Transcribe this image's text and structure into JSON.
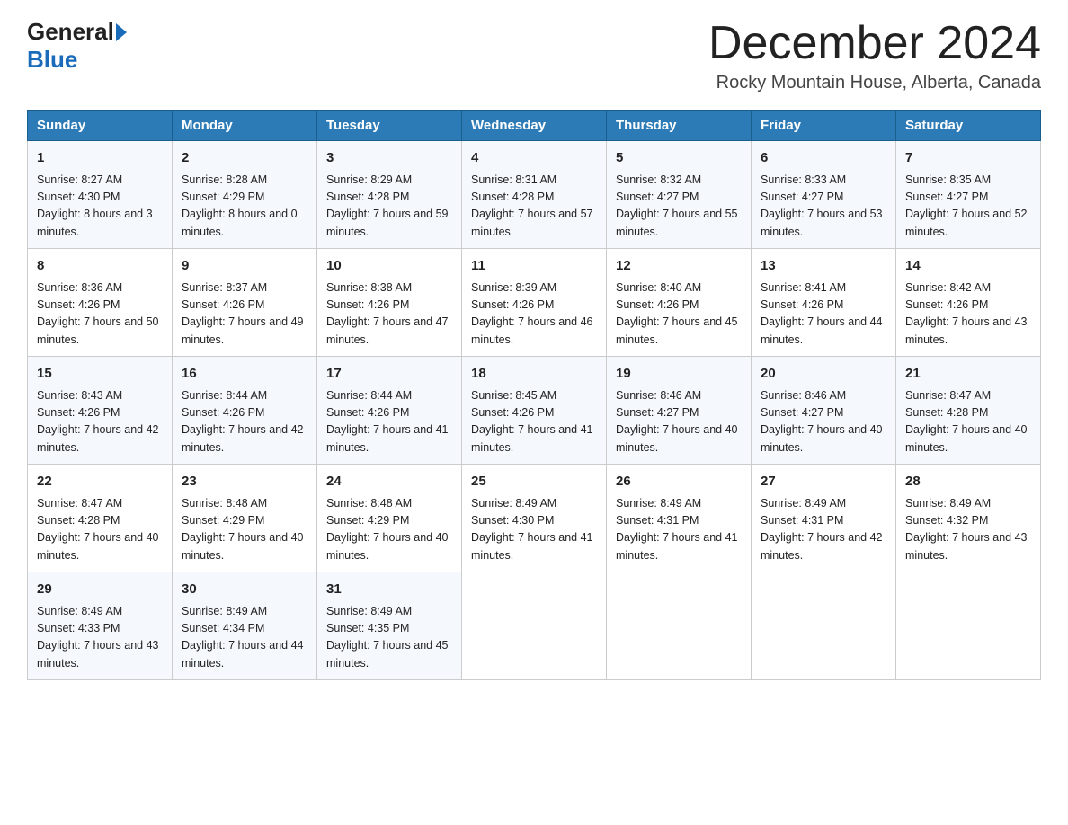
{
  "header": {
    "logo_general": "General",
    "logo_blue": "Blue",
    "month_title": "December 2024",
    "location": "Rocky Mountain House, Alberta, Canada"
  },
  "days_of_week": [
    "Sunday",
    "Monday",
    "Tuesday",
    "Wednesday",
    "Thursday",
    "Friday",
    "Saturday"
  ],
  "weeks": [
    [
      {
        "day": "1",
        "sunrise": "8:27 AM",
        "sunset": "4:30 PM",
        "daylight": "8 hours and 3 minutes."
      },
      {
        "day": "2",
        "sunrise": "8:28 AM",
        "sunset": "4:29 PM",
        "daylight": "8 hours and 0 minutes."
      },
      {
        "day": "3",
        "sunrise": "8:29 AM",
        "sunset": "4:28 PM",
        "daylight": "7 hours and 59 minutes."
      },
      {
        "day": "4",
        "sunrise": "8:31 AM",
        "sunset": "4:28 PM",
        "daylight": "7 hours and 57 minutes."
      },
      {
        "day": "5",
        "sunrise": "8:32 AM",
        "sunset": "4:27 PM",
        "daylight": "7 hours and 55 minutes."
      },
      {
        "day": "6",
        "sunrise": "8:33 AM",
        "sunset": "4:27 PM",
        "daylight": "7 hours and 53 minutes."
      },
      {
        "day": "7",
        "sunrise": "8:35 AM",
        "sunset": "4:27 PM",
        "daylight": "7 hours and 52 minutes."
      }
    ],
    [
      {
        "day": "8",
        "sunrise": "8:36 AM",
        "sunset": "4:26 PM",
        "daylight": "7 hours and 50 minutes."
      },
      {
        "day": "9",
        "sunrise": "8:37 AM",
        "sunset": "4:26 PM",
        "daylight": "7 hours and 49 minutes."
      },
      {
        "day": "10",
        "sunrise": "8:38 AM",
        "sunset": "4:26 PM",
        "daylight": "7 hours and 47 minutes."
      },
      {
        "day": "11",
        "sunrise": "8:39 AM",
        "sunset": "4:26 PM",
        "daylight": "7 hours and 46 minutes."
      },
      {
        "day": "12",
        "sunrise": "8:40 AM",
        "sunset": "4:26 PM",
        "daylight": "7 hours and 45 minutes."
      },
      {
        "day": "13",
        "sunrise": "8:41 AM",
        "sunset": "4:26 PM",
        "daylight": "7 hours and 44 minutes."
      },
      {
        "day": "14",
        "sunrise": "8:42 AM",
        "sunset": "4:26 PM",
        "daylight": "7 hours and 43 minutes."
      }
    ],
    [
      {
        "day": "15",
        "sunrise": "8:43 AM",
        "sunset": "4:26 PM",
        "daylight": "7 hours and 42 minutes."
      },
      {
        "day": "16",
        "sunrise": "8:44 AM",
        "sunset": "4:26 PM",
        "daylight": "7 hours and 42 minutes."
      },
      {
        "day": "17",
        "sunrise": "8:44 AM",
        "sunset": "4:26 PM",
        "daylight": "7 hours and 41 minutes."
      },
      {
        "day": "18",
        "sunrise": "8:45 AM",
        "sunset": "4:26 PM",
        "daylight": "7 hours and 41 minutes."
      },
      {
        "day": "19",
        "sunrise": "8:46 AM",
        "sunset": "4:27 PM",
        "daylight": "7 hours and 40 minutes."
      },
      {
        "day": "20",
        "sunrise": "8:46 AM",
        "sunset": "4:27 PM",
        "daylight": "7 hours and 40 minutes."
      },
      {
        "day": "21",
        "sunrise": "8:47 AM",
        "sunset": "4:28 PM",
        "daylight": "7 hours and 40 minutes."
      }
    ],
    [
      {
        "day": "22",
        "sunrise": "8:47 AM",
        "sunset": "4:28 PM",
        "daylight": "7 hours and 40 minutes."
      },
      {
        "day": "23",
        "sunrise": "8:48 AM",
        "sunset": "4:29 PM",
        "daylight": "7 hours and 40 minutes."
      },
      {
        "day": "24",
        "sunrise": "8:48 AM",
        "sunset": "4:29 PM",
        "daylight": "7 hours and 40 minutes."
      },
      {
        "day": "25",
        "sunrise": "8:49 AM",
        "sunset": "4:30 PM",
        "daylight": "7 hours and 41 minutes."
      },
      {
        "day": "26",
        "sunrise": "8:49 AM",
        "sunset": "4:31 PM",
        "daylight": "7 hours and 41 minutes."
      },
      {
        "day": "27",
        "sunrise": "8:49 AM",
        "sunset": "4:31 PM",
        "daylight": "7 hours and 42 minutes."
      },
      {
        "day": "28",
        "sunrise": "8:49 AM",
        "sunset": "4:32 PM",
        "daylight": "7 hours and 43 minutes."
      }
    ],
    [
      {
        "day": "29",
        "sunrise": "8:49 AM",
        "sunset": "4:33 PM",
        "daylight": "7 hours and 43 minutes."
      },
      {
        "day": "30",
        "sunrise": "8:49 AM",
        "sunset": "4:34 PM",
        "daylight": "7 hours and 44 minutes."
      },
      {
        "day": "31",
        "sunrise": "8:49 AM",
        "sunset": "4:35 PM",
        "daylight": "7 hours and 45 minutes."
      },
      null,
      null,
      null,
      null
    ]
  ],
  "label_sunrise": "Sunrise:",
  "label_sunset": "Sunset:",
  "label_daylight": "Daylight:"
}
